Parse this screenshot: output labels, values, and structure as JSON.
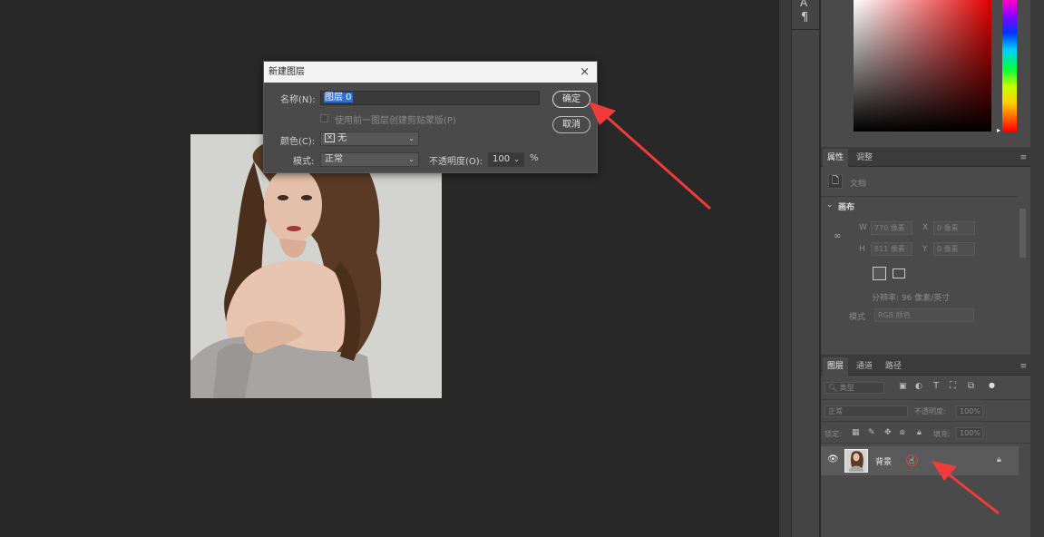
{
  "dialog": {
    "title": "新建图层",
    "close": "×",
    "name_label": "名称(N):",
    "name_value": "图层 0",
    "clip_label": "使用前一图层创建剪贴蒙版(P)",
    "color_label": "颜色(C):",
    "color_value": "无",
    "mode_label": "模式:",
    "mode_value": "正常",
    "opacity_label": "不透明度(O):",
    "opacity_value": "100",
    "opacity_unit": "%",
    "ok": "确定",
    "cancel": "取消"
  },
  "properties": {
    "tabs": [
      "属性",
      "调整"
    ],
    "doc_label": "文档",
    "canvas_label": "画布",
    "w_label": "W",
    "w_value": "770 像素",
    "h_label": "H",
    "h_value": "811 像素",
    "x_label": "X",
    "x_value": "0 像素",
    "y_label": "Y",
    "y_value": "0 像素",
    "resolution": "分辨率: 96 像素/英寸",
    "mode_label": "模式",
    "mode_value": "RGB 颜色"
  },
  "layers": {
    "tabs": [
      "图层",
      "通道",
      "路径"
    ],
    "filter_label": "类型",
    "blend_value": "正常",
    "opacity_label": "不透明度:",
    "opacity_value": "100%",
    "lock_label": "锁定:",
    "fill_label": "填充:",
    "fill_value": "100%",
    "layer_name": "背景"
  },
  "colors": {
    "annotation_arrow": "#ef3b3b",
    "selection_highlight": "#2f6fd6"
  }
}
